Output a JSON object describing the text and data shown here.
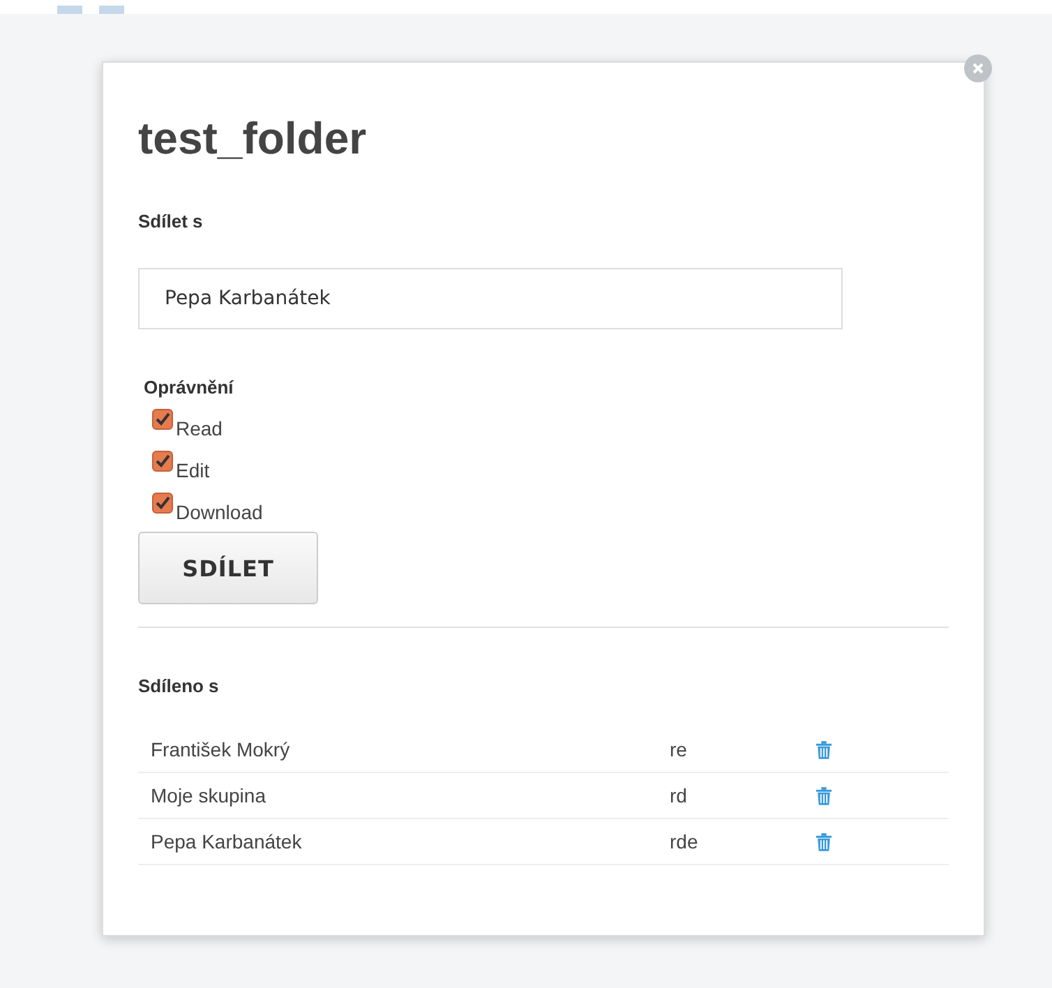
{
  "dialog": {
    "title": "test_folder",
    "share_with": {
      "label": "Sdílet s",
      "value": "Pepa Karbanátek"
    },
    "permissions": {
      "label": "Oprávnění",
      "items": [
        {
          "label": "Read",
          "checked": true
        },
        {
          "label": "Edit",
          "checked": true
        },
        {
          "label": "Download",
          "checked": true
        }
      ]
    },
    "share_button": "SDÍLET",
    "shared_with": {
      "label": "Sdíleno s",
      "rows": [
        {
          "name": "František Mokrý",
          "rights": "re"
        },
        {
          "name": "Moje skupina",
          "rights": "rd"
        },
        {
          "name": "Pepa Karbanátek",
          "rights": "rde"
        }
      ]
    }
  }
}
